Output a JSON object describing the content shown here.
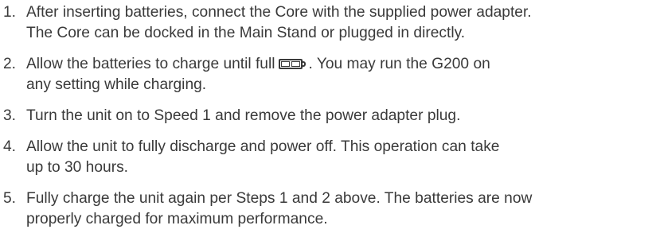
{
  "steps": [
    {
      "number": "1.",
      "lines": [
        "After inserting batteries, connect the Core with the supplied power adapter.",
        "The Core can be docked in the Main Stand or plugged in directly."
      ]
    },
    {
      "number": "2.",
      "line1_before_icon": "Allow the batteries to charge until full",
      "icon": "battery-full-icon",
      "line1_after_icon": ". You may run the G200 on",
      "line2": "any setting while charging."
    },
    {
      "number": "3.",
      "lines": [
        "Turn the unit on to Speed 1 and remove the power adapter plug."
      ]
    },
    {
      "number": "4.",
      "lines": [
        "Allow the unit to fully discharge and power off. This operation can take",
        "up to 30 hours."
      ]
    },
    {
      "number": "5.",
      "lines": [
        "Fully charge the unit again per Steps 1 and 2 above. The batteries are now",
        "properly charged for maximum performance."
      ]
    }
  ]
}
